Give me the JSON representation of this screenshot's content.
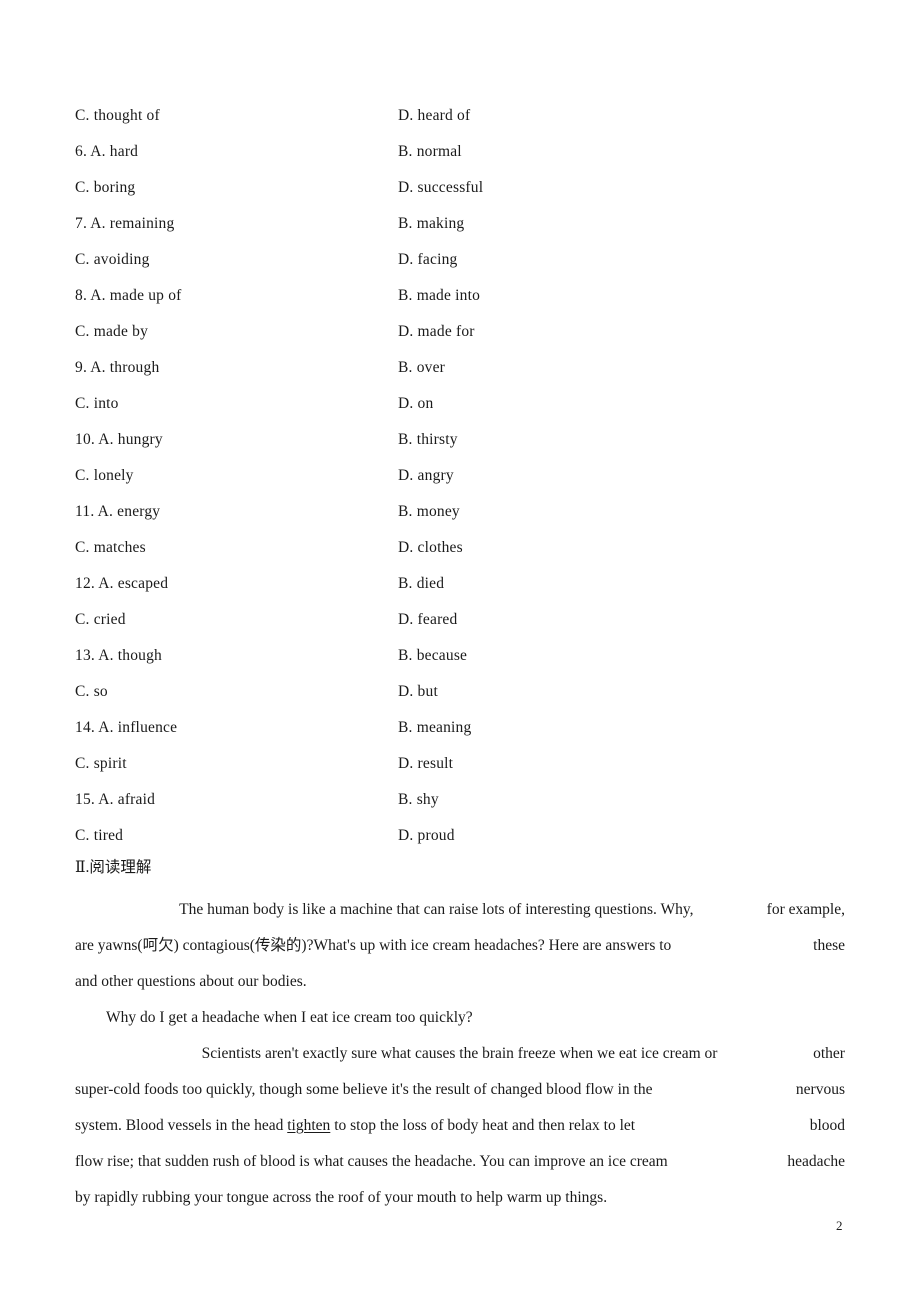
{
  "document": {
    "page_number": "2"
  },
  "cloze_options": {
    "rows": [
      {
        "left": "C. thought of",
        "right": "D. heard of"
      },
      {
        "left": "6. A. hard",
        "right": "B. normal"
      },
      {
        "left": "C. boring",
        "right": "D. successful"
      },
      {
        "left": "7. A. remaining",
        "right": "B. making"
      },
      {
        "left": "C. avoiding",
        "right": "D. facing"
      },
      {
        "left": "8. A. made up of",
        "right": "B. made into"
      },
      {
        "left": "C. made by",
        "right": "D. made for"
      },
      {
        "left": "9. A. through",
        "right": "B. over"
      },
      {
        "left": "C. into",
        "right": "D. on"
      },
      {
        "left": "10. A. hungry",
        "right": "B. thirsty"
      },
      {
        "left": "C. lonely",
        "right": "D. angry"
      },
      {
        "left": "11. A. energy",
        "right": "B. money"
      },
      {
        "left": "C. matches",
        "right": "D. clothes"
      },
      {
        "left": "12. A. escaped",
        "right": "B. died"
      },
      {
        "left": "C. cried",
        "right": "D. feared"
      },
      {
        "left": "13. A. though",
        "right": "B. because"
      },
      {
        "left": "C. so",
        "right": "D. but"
      },
      {
        "left": "14. A. influence",
        "right": "B. meaning"
      },
      {
        "left": "C. spirit",
        "right": "D. result"
      },
      {
        "left": "15. A. afraid",
        "right": "B. shy"
      },
      {
        "left": "C. tired",
        "right": "D. proud"
      }
    ]
  },
  "reading_section": {
    "heading": "Ⅱ.阅读理解",
    "paragraph1": {
      "line1_a": "The human body is like a machine that can raise lots of interesting questions. Why,",
      "line1_b": "for example,",
      "line2_a": "are yawns(呵欠) contagious(传染的)?What's up with ice cream headaches? Here are answers to",
      "line2_b": "these",
      "line3": "and other questions about our bodies."
    },
    "paragraph2": {
      "line1": "Why do I get a headache when I eat ice cream too quickly?"
    },
    "paragraph3": {
      "line1_a": "Scientists aren't exactly sure what causes the brain freeze when we eat ice cream or",
      "line1_b": "other",
      "line2_a": "super-cold foods too quickly, though some believe it's the result of changed blood flow in the",
      "line2_b": "nervous",
      "line3_a": "system. Blood vessels in the head ",
      "line3_underlined": "tighten",
      "line3_b": " to stop the loss of body heat and then relax to let",
      "line3_c": "blood",
      "line4_a": "flow rise; that sudden rush of blood is what causes the headache. You can improve an ice cream",
      "line4_b": "headache",
      "line5": "by rapidly rubbing your tongue across the roof of your mouth to help warm up things."
    }
  }
}
